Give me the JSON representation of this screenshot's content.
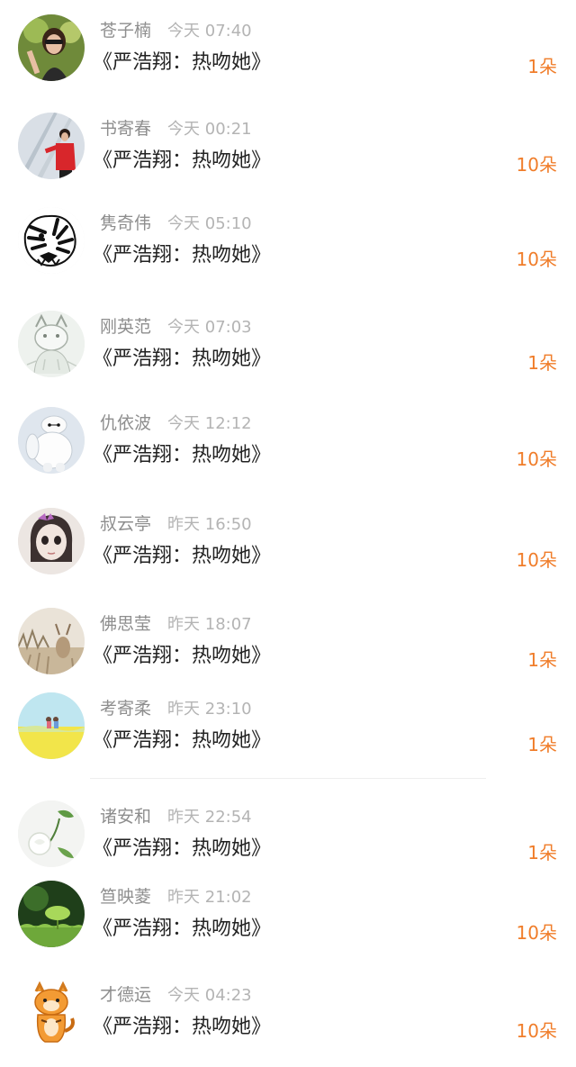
{
  "items": [
    {
      "name": "苍子楠",
      "time": "今天 07:40",
      "title": "《严浩翔：热吻她》",
      "count": "1朵",
      "avatar": "photo-woman-avatar"
    },
    {
      "name": "书寄春",
      "time": "今天 00:21",
      "title": "《严浩翔：热吻她》",
      "count": "10朵",
      "avatar": "photo-man-red-avatar"
    },
    {
      "name": "隽奇伟",
      "time": "今天 05:10",
      "title": "《严浩翔：热吻她》",
      "count": "10朵",
      "avatar": "tiger-sketch-avatar"
    },
    {
      "name": "刚英范",
      "time": "今天 07:03",
      "title": "《严浩翔：热吻她》",
      "count": "1朵",
      "avatar": "cat-sketch-avatar"
    },
    {
      "name": "仇依波",
      "time": "今天 12:12",
      "title": "《严浩翔：热吻她》",
      "count": "10朵",
      "avatar": "white-robot-avatar"
    },
    {
      "name": "叔云亭",
      "time": "昨天 16:50",
      "title": "《严浩翔：热吻她》",
      "count": "10朵",
      "avatar": "doll-girl-avatar"
    },
    {
      "name": "佛思莹",
      "time": "昨天 18:07",
      "title": "《严浩翔：热吻她》",
      "count": "1朵",
      "avatar": "deer-field-avatar"
    },
    {
      "name": "考寄柔",
      "time": "昨天 23:10",
      "title": "《严浩翔：热吻她》",
      "count": "1朵",
      "avatar": "yellow-field-avatar"
    },
    {
      "name": "诸安和",
      "time": "昨天 22:54",
      "title": "《严浩翔：热吻她》",
      "count": "1朵",
      "avatar": "white-rose-avatar"
    },
    {
      "name": "笪映菱",
      "time": "昨天 21:02",
      "title": "《严浩翔：热吻她》",
      "count": "10朵",
      "avatar": "green-sprout-avatar"
    },
    {
      "name": "才德运",
      "time": "今天 04:23",
      "title": "《严浩翔：热吻她》",
      "count": "10朵",
      "avatar": "cartoon-tiger-avatar"
    }
  ],
  "colors": {
    "name": "#8e8e8e",
    "time": "#b4b4b4",
    "title": "#222222",
    "count": "#f07d2a"
  }
}
